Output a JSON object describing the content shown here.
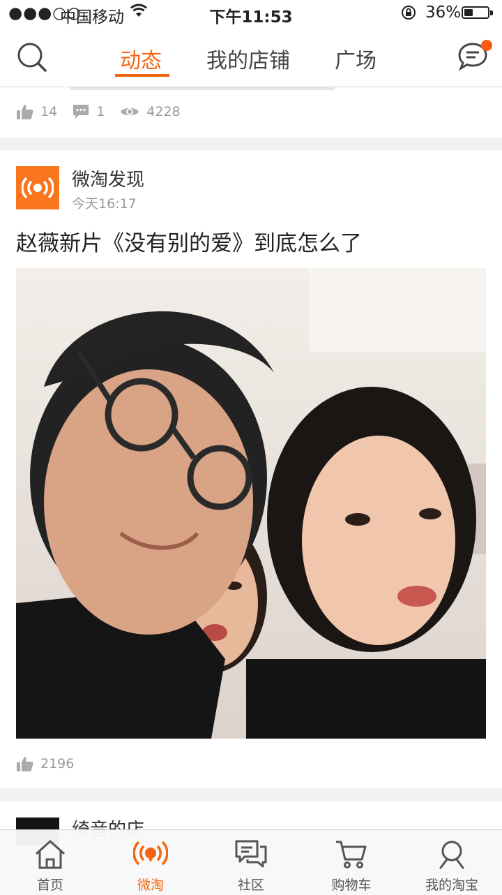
{
  "status_bar": {
    "signal": "●●●○○",
    "carrier": "中国移动",
    "time": "下午11:53",
    "battery_pct": "36%",
    "battery_level": 0.36
  },
  "nav": {
    "tabs": [
      {
        "label": "动态",
        "active": true
      },
      {
        "label": "我的店铺",
        "active": false
      },
      {
        "label": "广场",
        "active": false
      }
    ]
  },
  "prev_post": {
    "likes": "14",
    "comments": "1",
    "views": "4228"
  },
  "post": {
    "author": "微淘发现",
    "time": "今天16:17",
    "title": "赵薇新片《没有别的爱》到底怎么了",
    "likes": "2196"
  },
  "next_post": {
    "author": "绮音的店"
  },
  "tabbar": {
    "items": [
      {
        "label": "首页",
        "icon": "home-icon",
        "active": false
      },
      {
        "label": "微淘",
        "icon": "broadcast-icon",
        "active": true
      },
      {
        "label": "社区",
        "icon": "chat-bubbles-icon",
        "active": false
      },
      {
        "label": "购物车",
        "icon": "cart-icon",
        "active": false
      },
      {
        "label": "我的淘宝",
        "icon": "profile-icon",
        "active": false
      }
    ]
  },
  "colors": {
    "accent": "#f56511",
    "badge": "#ff5a12"
  }
}
